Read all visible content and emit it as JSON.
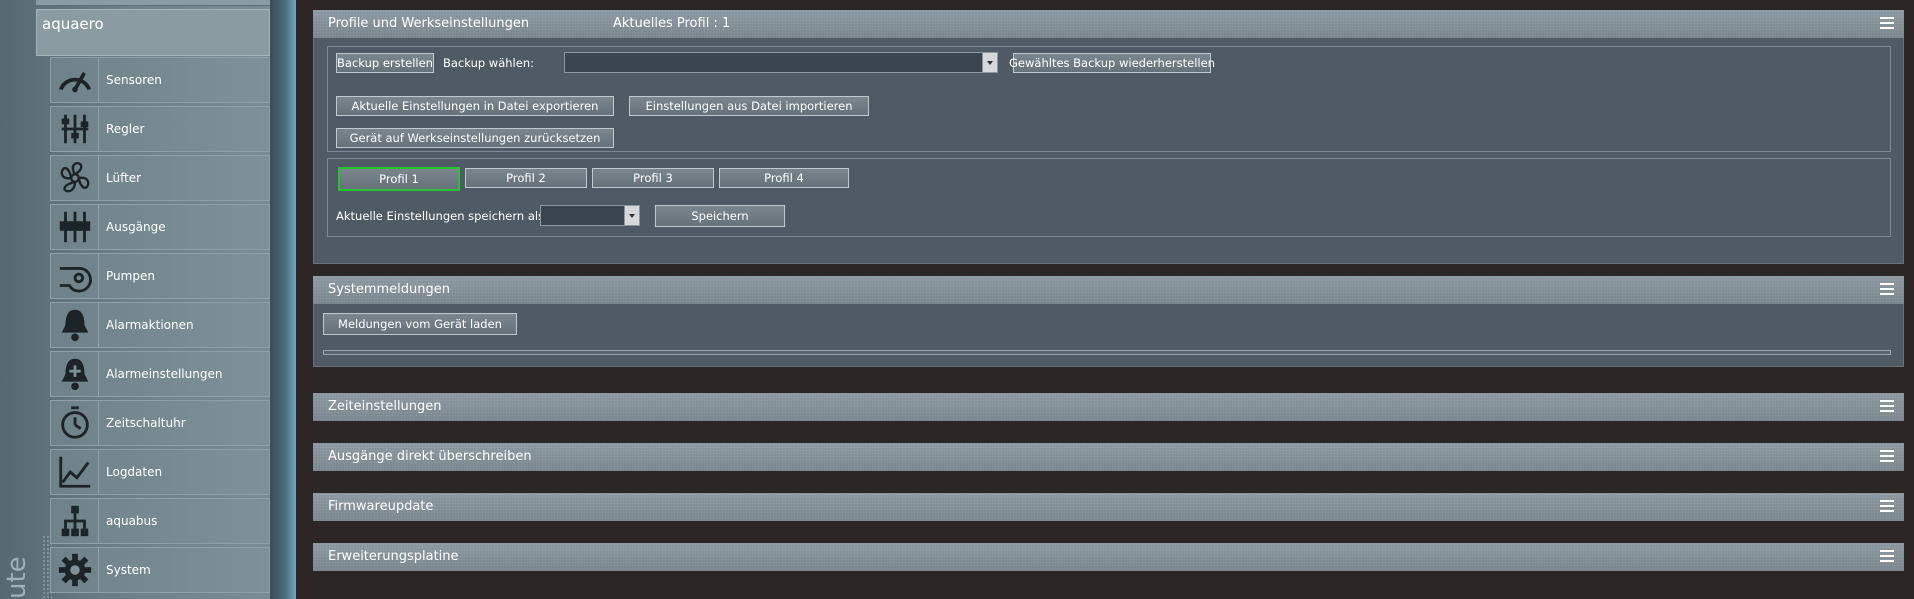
{
  "sidebar": {
    "device_name": "aquaero",
    "vertical_text": "uter",
    "items": [
      {
        "label": "Sensoren",
        "icon": "gauge-icon"
      },
      {
        "label": "Regler",
        "icon": "sliders-icon"
      },
      {
        "label": "Lüfter",
        "icon": "fan-icon"
      },
      {
        "label": "Ausgänge",
        "icon": "outputs-icon"
      },
      {
        "label": "Pumpen",
        "icon": "pump-icon"
      },
      {
        "label": "Alarmaktionen",
        "icon": "bell-icon"
      },
      {
        "label": "Alarmeinstellungen",
        "icon": "bell-plus-icon"
      },
      {
        "label": "Zeitschaltuhr",
        "icon": "timer-icon"
      },
      {
        "label": "Logdaten",
        "icon": "chart-line-icon"
      },
      {
        "label": "aquabus",
        "icon": "network-tree-icon"
      },
      {
        "label": "System",
        "icon": "gear-icon"
      }
    ]
  },
  "profiles_panel": {
    "title": "Profile und Werkseinstellungen",
    "current_profile": "Aktuelles Profil : 1",
    "backup_create": "Backup erstellen",
    "backup_select_label": "Backup wählen:",
    "backup_select_value": "",
    "backup_restore": "Gewähltes Backup wiederherstellen",
    "export": "Aktuelle Einstellungen in Datei exportieren",
    "import": "Einstellungen aus Datei importieren",
    "factory_reset": "Gerät auf Werkseinstellungen zurücksetzen",
    "profiles": [
      "Profil 1",
      "Profil 2",
      "Profil 3",
      "Profil 4"
    ],
    "active_profile_index": 0,
    "save_as_label": "Aktuelle Einstellungen speichern als",
    "save_as_value": "",
    "save_button": "Speichern"
  },
  "system_panel": {
    "title": "Systemmeldungen",
    "load_button": "Meldungen vom Gerät laden",
    "progress": 0
  },
  "collapsed_panels": [
    {
      "title": "Zeiteinstellungen"
    },
    {
      "title": "Ausgänge direkt überschreiben"
    },
    {
      "title": "Firmwareupdate"
    },
    {
      "title": "Erweiterungsplatine"
    }
  ],
  "colors": {
    "active_profile_border": "#27c230",
    "panel_body": "#4f5a64",
    "background": "#2b2625"
  }
}
